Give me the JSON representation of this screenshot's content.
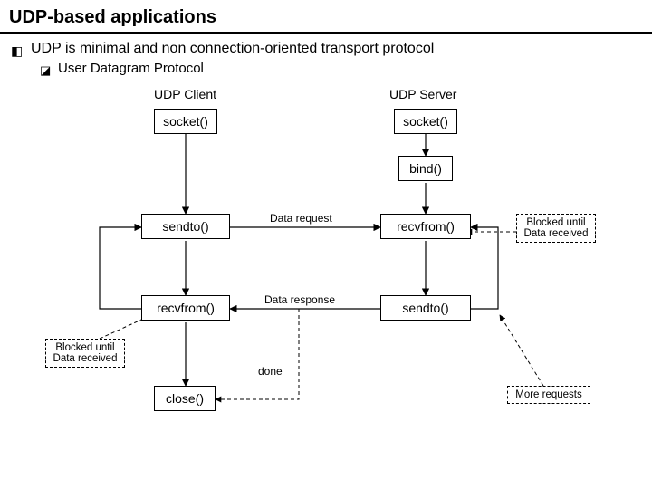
{
  "title": "UDP-based applications",
  "bullet1": "UDP is minimal and non connection-oriented transport protocol",
  "bullet2": "User Datagram Protocol",
  "diagram": {
    "client_header": "UDP Client",
    "server_header": "UDP Server",
    "client": {
      "socket": "socket()",
      "sendto": "sendto()",
      "recvfrom": "recvfrom()",
      "close": "close()"
    },
    "server": {
      "socket": "socket()",
      "bind": "bind()",
      "recvfrom": "recvfrom()",
      "sendto": "sendto()"
    },
    "labels": {
      "data_request": "Data request",
      "data_response": "Data response",
      "done": "done"
    },
    "notes": {
      "blocked_client": "Blocked until\nData received",
      "blocked_server": "Blocked until\nData received",
      "more_requests": "More requests"
    }
  }
}
